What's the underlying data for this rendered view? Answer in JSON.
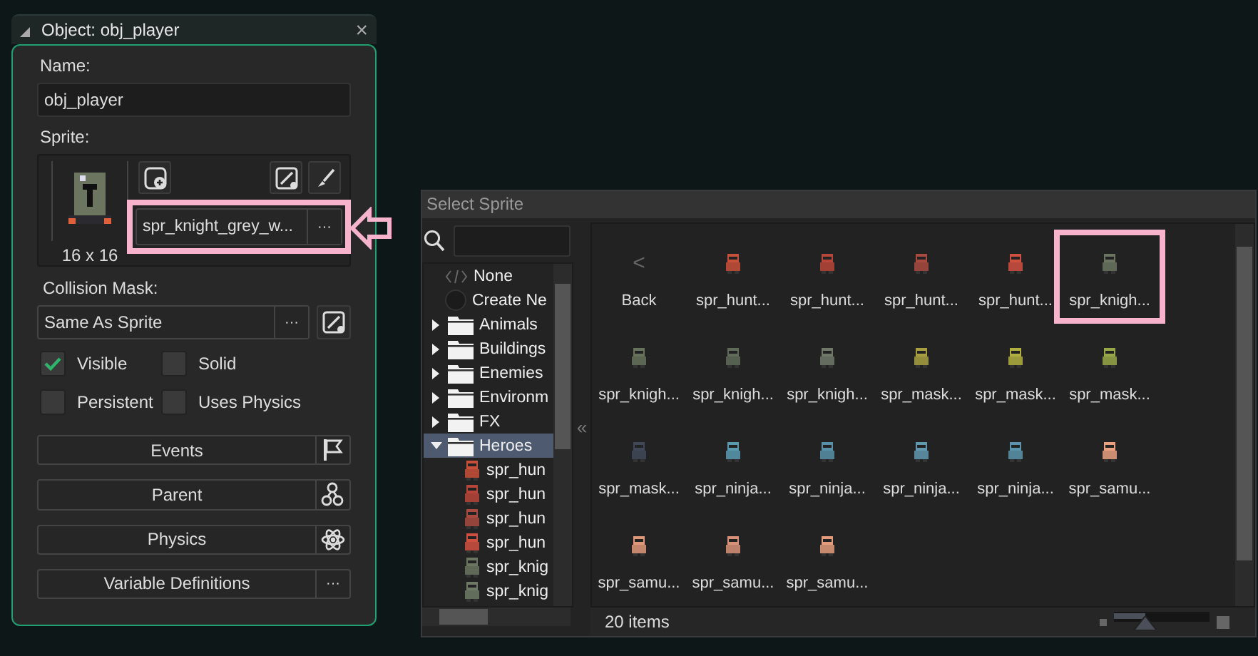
{
  "object_window": {
    "title": "Object: obj_player",
    "close": "×"
  },
  "name": {
    "label": "Name:",
    "value": "obj_player"
  },
  "sprite": {
    "label": "Sprite:",
    "size": "16 x 16",
    "value": "spr_knight_grey_w...",
    "more": "···",
    "highlighted": true,
    "color": "#6b7560"
  },
  "collision_mask": {
    "label": "Collision Mask:",
    "value": "Same As Sprite",
    "more": "···"
  },
  "checkboxes": [
    {
      "label": "Visible",
      "checked": true
    },
    {
      "label": "Solid",
      "checked": false
    },
    {
      "label": "Persistent",
      "checked": false
    },
    {
      "label": "Uses Physics",
      "checked": false
    }
  ],
  "buttons": [
    {
      "label": "Events",
      "kind": "flag"
    },
    {
      "label": "Parent",
      "kind": "tree"
    },
    {
      "label": "Physics",
      "kind": "atom"
    },
    {
      "label": "Variable Definitions",
      "kind": "more",
      "text": "···"
    }
  ],
  "select_sprite": {
    "title": "Select Sprite",
    "collapse": "«",
    "tree": [
      {
        "kind": "none",
        "label": "None"
      },
      {
        "kind": "create",
        "label": "Create Ne"
      },
      {
        "kind": "folder",
        "label": "Animals",
        "expanded": false,
        "selected": false
      },
      {
        "kind": "folder",
        "label": "Buildings",
        "expanded": false,
        "selected": false
      },
      {
        "kind": "folder",
        "label": "Enemies",
        "expanded": false,
        "selected": false
      },
      {
        "kind": "folder",
        "label": "Environm",
        "expanded": false,
        "selected": false
      },
      {
        "kind": "folder",
        "label": "FX",
        "expanded": false,
        "selected": false
      },
      {
        "kind": "folder",
        "label": "Heroes",
        "expanded": true,
        "selected": true,
        "children": [
          {
            "kind": "sprite",
            "label": "spr_hun",
            "color": "#c8503a"
          },
          {
            "kind": "sprite",
            "label": "spr_hun",
            "color": "#b8453a"
          },
          {
            "kind": "sprite",
            "label": "spr_hun",
            "color": "#a84a40"
          },
          {
            "kind": "sprite",
            "label": "spr_hun",
            "color": "#d05040"
          },
          {
            "kind": "sprite",
            "label": "spr_knig",
            "color": "#6b7560"
          },
          {
            "kind": "sprite",
            "label": "spr_knig",
            "color": "#6f7a66"
          }
        ]
      }
    ],
    "grid": [
      {
        "kind": "back",
        "label": "Back",
        "glyph": "<"
      },
      {
        "kind": "sprite",
        "label": "spr_hunt...",
        "color": "#c8503a",
        "highlighted": false
      },
      {
        "kind": "sprite",
        "label": "spr_hunt...",
        "color": "#b8453a",
        "highlighted": false
      },
      {
        "kind": "sprite",
        "label": "spr_hunt...",
        "color": "#a84a40",
        "highlighted": false
      },
      {
        "kind": "sprite",
        "label": "spr_hunt...",
        "color": "#d05040",
        "highlighted": false
      },
      {
        "kind": "sprite",
        "label": "spr_knigh...",
        "color": "#6b7560",
        "highlighted": true
      },
      {
        "kind": "sprite",
        "label": "spr_knigh...",
        "color": "#66725c",
        "highlighted": false
      },
      {
        "kind": "sprite",
        "label": "spr_knigh...",
        "color": "#5f6b58",
        "highlighted": false
      },
      {
        "kind": "sprite",
        "label": "spr_knigh...",
        "color": "#70786a",
        "highlighted": false
      },
      {
        "kind": "sprite",
        "label": "spr_mask...",
        "color": "#a8a040",
        "highlighted": false
      },
      {
        "kind": "sprite",
        "label": "spr_mask...",
        "color": "#b0b040",
        "highlighted": false
      },
      {
        "kind": "sprite",
        "label": "spr_mask...",
        "color": "#98a848",
        "highlighted": false
      },
      {
        "kind": "sprite",
        "label": "spr_mask...",
        "color": "#404858",
        "highlighted": false
      },
      {
        "kind": "sprite",
        "label": "spr_ninja...",
        "color": "#5a9ab0",
        "highlighted": false
      },
      {
        "kind": "sprite",
        "label": "spr_ninja...",
        "color": "#5890a8",
        "highlighted": false
      },
      {
        "kind": "sprite",
        "label": "spr_ninja...",
        "color": "#6098b0",
        "highlighted": false
      },
      {
        "kind": "sprite",
        "label": "spr_ninja...",
        "color": "#5a94ac",
        "highlighted": false
      },
      {
        "kind": "sprite",
        "label": "spr_samu...",
        "color": "#e8a080",
        "highlighted": false
      },
      {
        "kind": "sprite",
        "label": "spr_samu...",
        "color": "#e0987a",
        "highlighted": false
      },
      {
        "kind": "sprite",
        "label": "spr_samu...",
        "color": "#d89078",
        "highlighted": false
      },
      {
        "kind": "sprite",
        "label": "spr_samu...",
        "color": "#e49c7c",
        "highlighted": false
      }
    ],
    "status": "20 items",
    "zoom": {
      "level": 0.33
    }
  }
}
